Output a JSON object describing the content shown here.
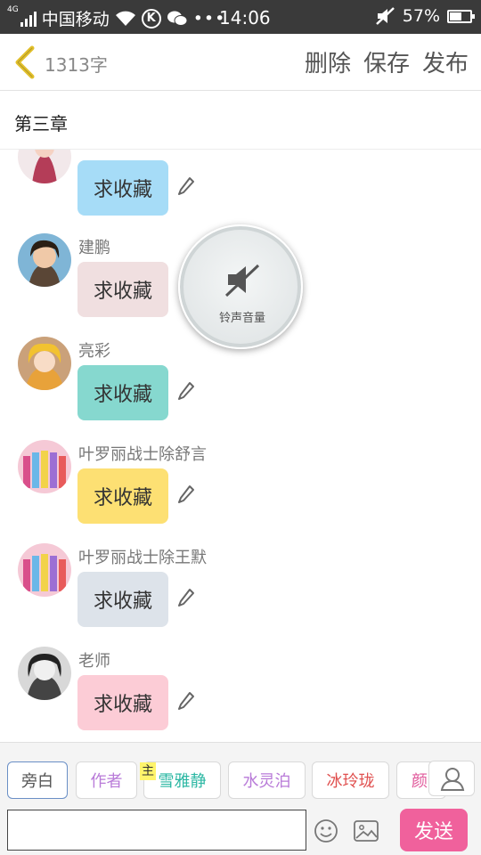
{
  "status_bar": {
    "network": "4G",
    "carrier": "中国移动",
    "time": "14:06",
    "battery_percent": 57,
    "battery_label": "57%"
  },
  "header": {
    "word_count": "1313字",
    "actions": [
      "删除",
      "保存",
      "发布"
    ]
  },
  "chapter": {
    "title": "第三章"
  },
  "messages": [
    {
      "name": "",
      "text": "求收藏",
      "bubble_color": "#a6dcf7"
    },
    {
      "name": "建鹏",
      "text": "求收藏",
      "bubble_color": "#f0dfe0"
    },
    {
      "name": "亮彩",
      "text": "求收藏",
      "bubble_color": "#86d8cf"
    },
    {
      "name": "叶罗丽战士除舒言",
      "text": "求收藏",
      "bubble_color": "#fde073"
    },
    {
      "name": "叶罗丽战士除王默",
      "text": "求收藏",
      "bubble_color": "#dde3ea"
    },
    {
      "name": "老师",
      "text": "求收藏",
      "bubble_color": "#fcccd6"
    }
  ],
  "volume_toast": {
    "label": "铃声音量",
    "icon": "speaker-muted-icon"
  },
  "roles": {
    "host_tag": "主",
    "items": [
      {
        "label": "旁白",
        "color": "#555555",
        "active": true
      },
      {
        "label": "作者",
        "color": "#b87ad8",
        "active": false
      },
      {
        "label": "雪雅静",
        "color": "#2bb7a3",
        "active": false
      },
      {
        "label": "水灵泊",
        "color": "#b87ad8",
        "active": false
      },
      {
        "label": "冰玲珑",
        "color": "#e0504f",
        "active": false
      },
      {
        "label": "颜",
        "color": "#e0579a",
        "active": false
      }
    ]
  },
  "input_bar": {
    "input_value": "",
    "input_placeholder": "",
    "send_label": "发送"
  },
  "colors": {
    "accent_pink": "#f0619c",
    "back_arrow": "#e2c02c"
  }
}
